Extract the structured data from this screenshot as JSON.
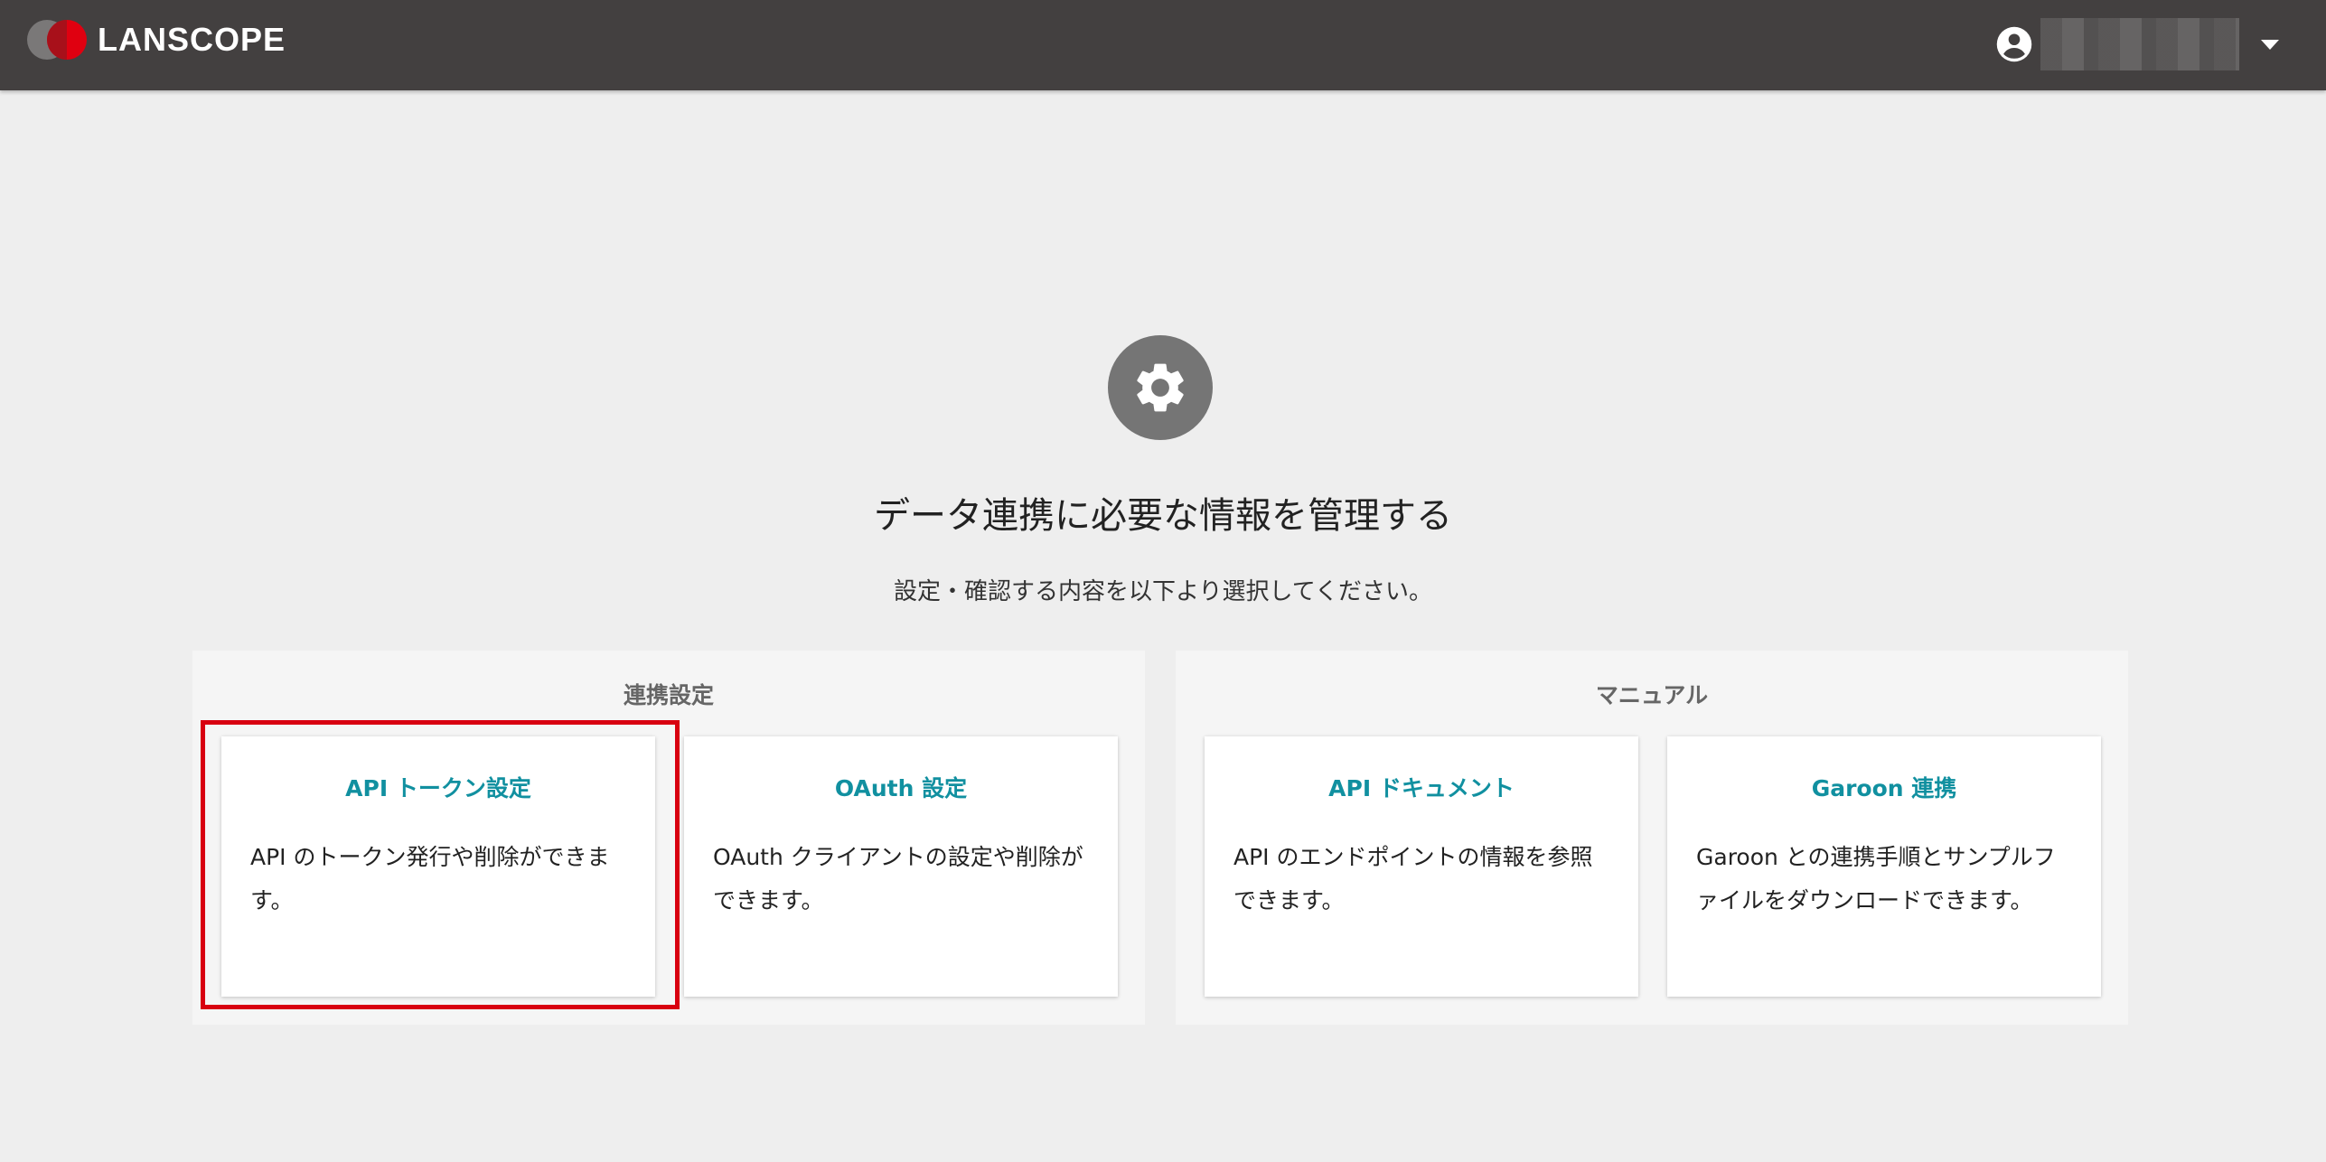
{
  "header": {
    "logo_text": "LANSCOPE",
    "user_name": ""
  },
  "hero": {
    "icon": "gear-icon",
    "title": "データ連携に必要な情報を管理する",
    "subtitle": "設定・確認する内容を以下より選択してください。"
  },
  "sections": [
    {
      "title": "連携設定",
      "cards": [
        {
          "title": "API トークン設定",
          "description": "API のトークン発行や削除ができます。"
        },
        {
          "title": "OAuth 設定",
          "description": "OAuth クライアントの設定や削除ができます。"
        }
      ]
    },
    {
      "title": "マニュアル",
      "cards": [
        {
          "title": "API ドキュメント",
          "description": "API のエンドポイントの情報を参照できます。"
        },
        {
          "title": "Garoon 連携",
          "description": "Garoon との連携手順とサンプルファイルをダウンロードできます。"
        }
      ]
    }
  ],
  "colors": {
    "header_bg": "#434040",
    "accent": "#1190a0",
    "highlight": "#d80010",
    "brand_red": "#e00010"
  }
}
